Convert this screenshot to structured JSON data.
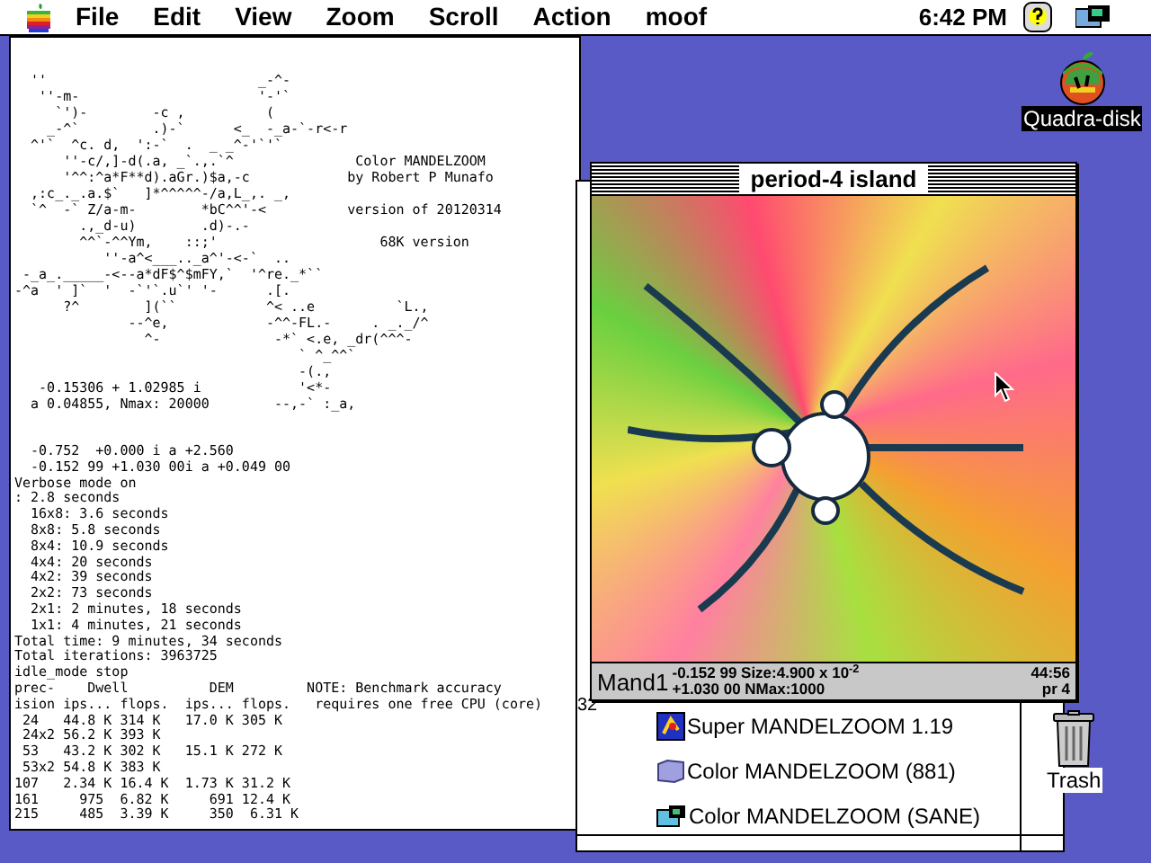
{
  "menu_bar": {
    "items": [
      "File",
      "Edit",
      "View",
      "Zoom",
      "Scroll",
      "Action",
      "moof"
    ],
    "clock": "6:42 PM"
  },
  "console": {
    "art_lines": [
      "  ''                          _-^-",
      "   ''-m-                      '-'`",
      "     `')-        -c ,          (",
      "    _-^`         .)-`      <_  -_a-`-r<-r",
      "  ^'`  ^c. d,  ':-`  .  _ _^-'`'`",
      "      ''-c/,]-d(.a, _`.,.`^               Color MANDELZOOM",
      "      '^^:^a*F**d).aGr.)$a,-c            by Robert P Munafo",
      "  ,:c_._.a.$`   ]*^^^^^-/a,L_,. _,",
      "  `^  -` Z/a-m-        *bC^^'-<          version of 20120314",
      "        .,_d-u)        .d)-.-",
      "        ^^`-^^Ym,    ::;'                    68K version",
      "           ''-a^<___.._a^'-<-`  ..",
      " -_a_._____-<--a*dF$^$mFY,`  '^re._*``",
      "-^a  ' ]`  '  -`'`.u`' '-      .[.",
      "      ?^        ](``           ^< ..e          `L.,",
      "              --^e,            -^^-FL.-     . _._/^",
      "                ^-              -*` <.e, _dr(^^^-",
      "                                   ` ^_^^`",
      "                                   -(.,",
      "   -0.15306 + 1.02985 i            '<*-",
      "  a 0.04855, Nmax: 20000        --,-` :_a,"
    ],
    "output_lines": [
      "  -0.752  +0.000 i a +2.560",
      "  -0.152 99 +1.030 00i a +0.049 00",
      "Verbose mode on",
      ": 2.8 seconds",
      "  16x8: 3.6 seconds",
      "  8x8: 5.8 seconds",
      "  8x4: 10.9 seconds",
      "  4x4: 20 seconds",
      "  4x2: 39 seconds",
      "  2x2: 73 seconds",
      "  2x1: 2 minutes, 18 seconds",
      "  1x1: 4 minutes, 21 seconds",
      "Total time: 9 minutes, 34 seconds",
      "Total iterations: 3963725",
      "idle_mode stop",
      "prec-    Dwell          DEM         NOTE: Benchmark accuracy",
      "ision ips... flops.  ips... flops.   requires one free CPU (core)",
      " 24   44.8 K 314 K   17.0 K 305 K",
      " 24x2 56.2 K 393 K",
      " 53   43.2 K 302 K   15.1 K 272 K",
      " 53x2 54.8 K 383 K",
      "107   2.34 K 16.4 K  1.73 K 31.2 K",
      "161     975  6.82 K     691 12.4 K",
      "215     485  3.39 K     350  6.31 K"
    ]
  },
  "finder_window": {
    "partial_text": "32",
    "files": [
      {
        "name": "Super MANDELZOOM 1.19",
        "kind": "app"
      },
      {
        "name": "Color MANDELZOOM (881)",
        "kind": "doc"
      },
      {
        "name": "Color MANDELZOOM (SANE)",
        "kind": "sane"
      }
    ]
  },
  "fractal_window": {
    "title": "period-4 island",
    "status": {
      "name": "Mand1",
      "line_1": "-0.152 99 Size:4.900 x 10$^{-2}$",
      "line_2": "+1.030 00 NMax:1000",
      "time": "44:56",
      "precision": "pr 4"
    }
  },
  "desktop_icons": [
    {
      "label": "Quadra-disk",
      "kind": "disk"
    },
    {
      "label": "Trash",
      "kind": "trash"
    }
  ]
}
